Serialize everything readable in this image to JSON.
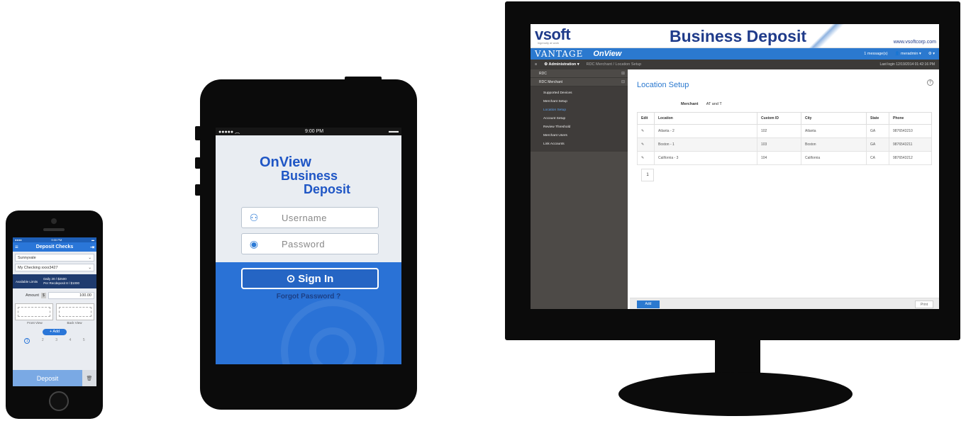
{
  "small_phone": {
    "status_time": "9:00 PM",
    "nav_title": "Deposit Checks",
    "location": "Sunnyvale",
    "account": "My Checking xxxx3427",
    "limits_label": "Available Limits",
    "limit_daily": "Daily 20 / $2500",
    "limit_per": "Per Recdeposit 8 / $1000",
    "amount_label": "Amount",
    "amount_currency": "$",
    "amount_value": "100.00",
    "front_label": "Front View",
    "back_label": "Back View",
    "add_label": "Add",
    "steps": [
      "1",
      "2",
      "3",
      "4",
      "5"
    ],
    "deposit_label": "Deposit"
  },
  "medium_phone": {
    "status_time": "9:00 PM",
    "logo_line1": "OnView",
    "logo_line2": "Business",
    "logo_line3": "Deposit",
    "username_placeholder": "Username",
    "password_placeholder": "Password",
    "signin_label": "Sign In",
    "forgot_label": "Forgot Password ?"
  },
  "desktop": {
    "vsoft": "vsoft",
    "vsoft_tag": "ingenuity at work",
    "header_title": "Business Deposit",
    "url": "www.vsoftcorp.com",
    "brand_vantage": "VANTAGE",
    "brand_onview": "OnView",
    "messages": "1 message(s)",
    "user": "meradmin",
    "menu_label": "Administration",
    "breadcrumb": "RDC Merchant  /  Location Setup",
    "last_login": "Last login 12/19/2014 01:42:16 PM",
    "sidebar": {
      "group1": "RDC",
      "group2": "RDC Merchant",
      "items": [
        "Supported Devices",
        "Merchant Setup",
        "Location Setup",
        "Account Setup",
        "Review Threshold",
        "Merchant Users",
        "Link Accounts"
      ]
    },
    "page_title": "Location Setup",
    "merchant_label": "Merchant",
    "merchant_value": "AT and T",
    "table": {
      "headers": [
        "Edit",
        "Location",
        "Custom ID",
        "City",
        "State",
        "Phone"
      ],
      "rows": [
        [
          "Atlanta - 2",
          "102",
          "Atlanta",
          "GA",
          "9876543210"
        ],
        [
          "Boston - 1",
          "103",
          "Boston",
          "GA",
          "9876543211"
        ],
        [
          "California - 3",
          "104",
          "California",
          "CA",
          "9876543212"
        ]
      ]
    },
    "page_number": "1",
    "add_label": "Add",
    "print_label": "Print"
  }
}
